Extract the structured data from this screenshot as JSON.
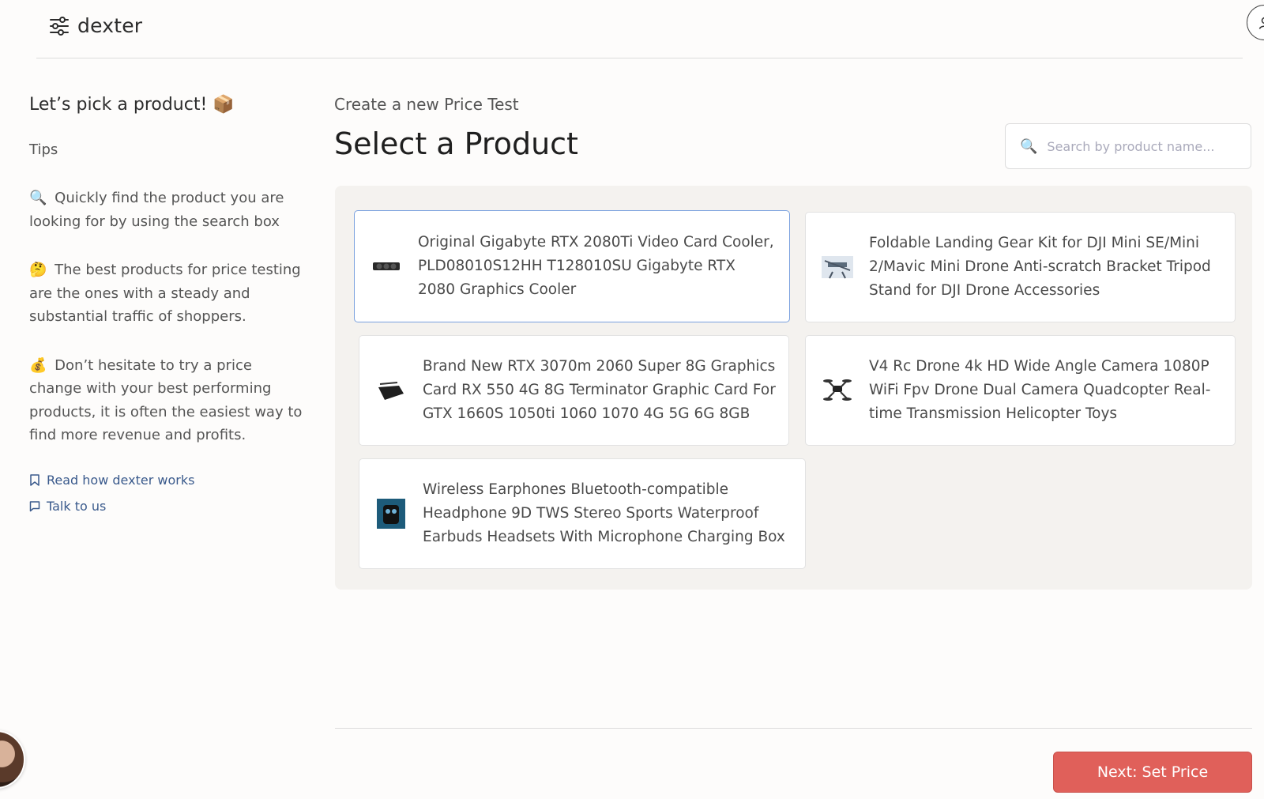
{
  "app": {
    "name": "dexter"
  },
  "sidebar": {
    "title": "Let’s pick a product! 📦",
    "tips_label": "Tips",
    "tips": [
      {
        "emoji": "🔍",
        "text": "Quickly find the product you are looking for by using the search box"
      },
      {
        "emoji": "🤔",
        "text": "The best products for price testing are the ones with a steady and substantial traffic of shoppers."
      },
      {
        "emoji": "💰",
        "text": "Don’t hesitate to try a price change with your best performing products, it is often the easiest way to find more revenue and profits."
      }
    ],
    "links": [
      {
        "label": "Read how dexter works",
        "icon": "bookmark-icon"
      },
      {
        "label": "Talk to us",
        "icon": "chat-icon"
      }
    ]
  },
  "main": {
    "subtitle": "Create a new Price Test",
    "title": "Select a Product",
    "search": {
      "placeholder": "Search by product name..."
    },
    "products": [
      {
        "title": "Original Gigabyte RTX 2080Ti Video Card Cooler, PLD08010S12HH T128010SU Gigabyte RTX 2080 Graphics Cooler",
        "selected": true
      },
      {
        "title": "Foldable Landing Gear Kit for DJI Mini SE/Mini 2/Mavic Mini Drone Anti-scratch Bracket Tripod Stand for DJI Drone Accessories",
        "selected": false
      },
      {
        "title": "Brand New RTX 3070m 2060 Super 8G Graphics Card RX 550 4G 8G Terminator Graphic Card For GTX 1660S 1050ti 1060 1070 4G 5G 6G 8GB",
        "selected": false
      },
      {
        "title": "V4 Rc Drone 4k HD Wide Angle Camera 1080P WiFi Fpv Drone Dual Camera Quadcopter Real-time Transmission Helicopter Toys",
        "selected": false
      },
      {
        "title": "Wireless Earphones Bluetooth-compatible Headphone 9D TWS Stereo Sports Waterproof Earbuds Headsets With Microphone Charging Box",
        "selected": false
      }
    ],
    "next_button": "Next: Set Price"
  },
  "colors": {
    "accent": "#e0605a",
    "link": "#3a5a8c",
    "selected_border": "#7aa1df"
  }
}
